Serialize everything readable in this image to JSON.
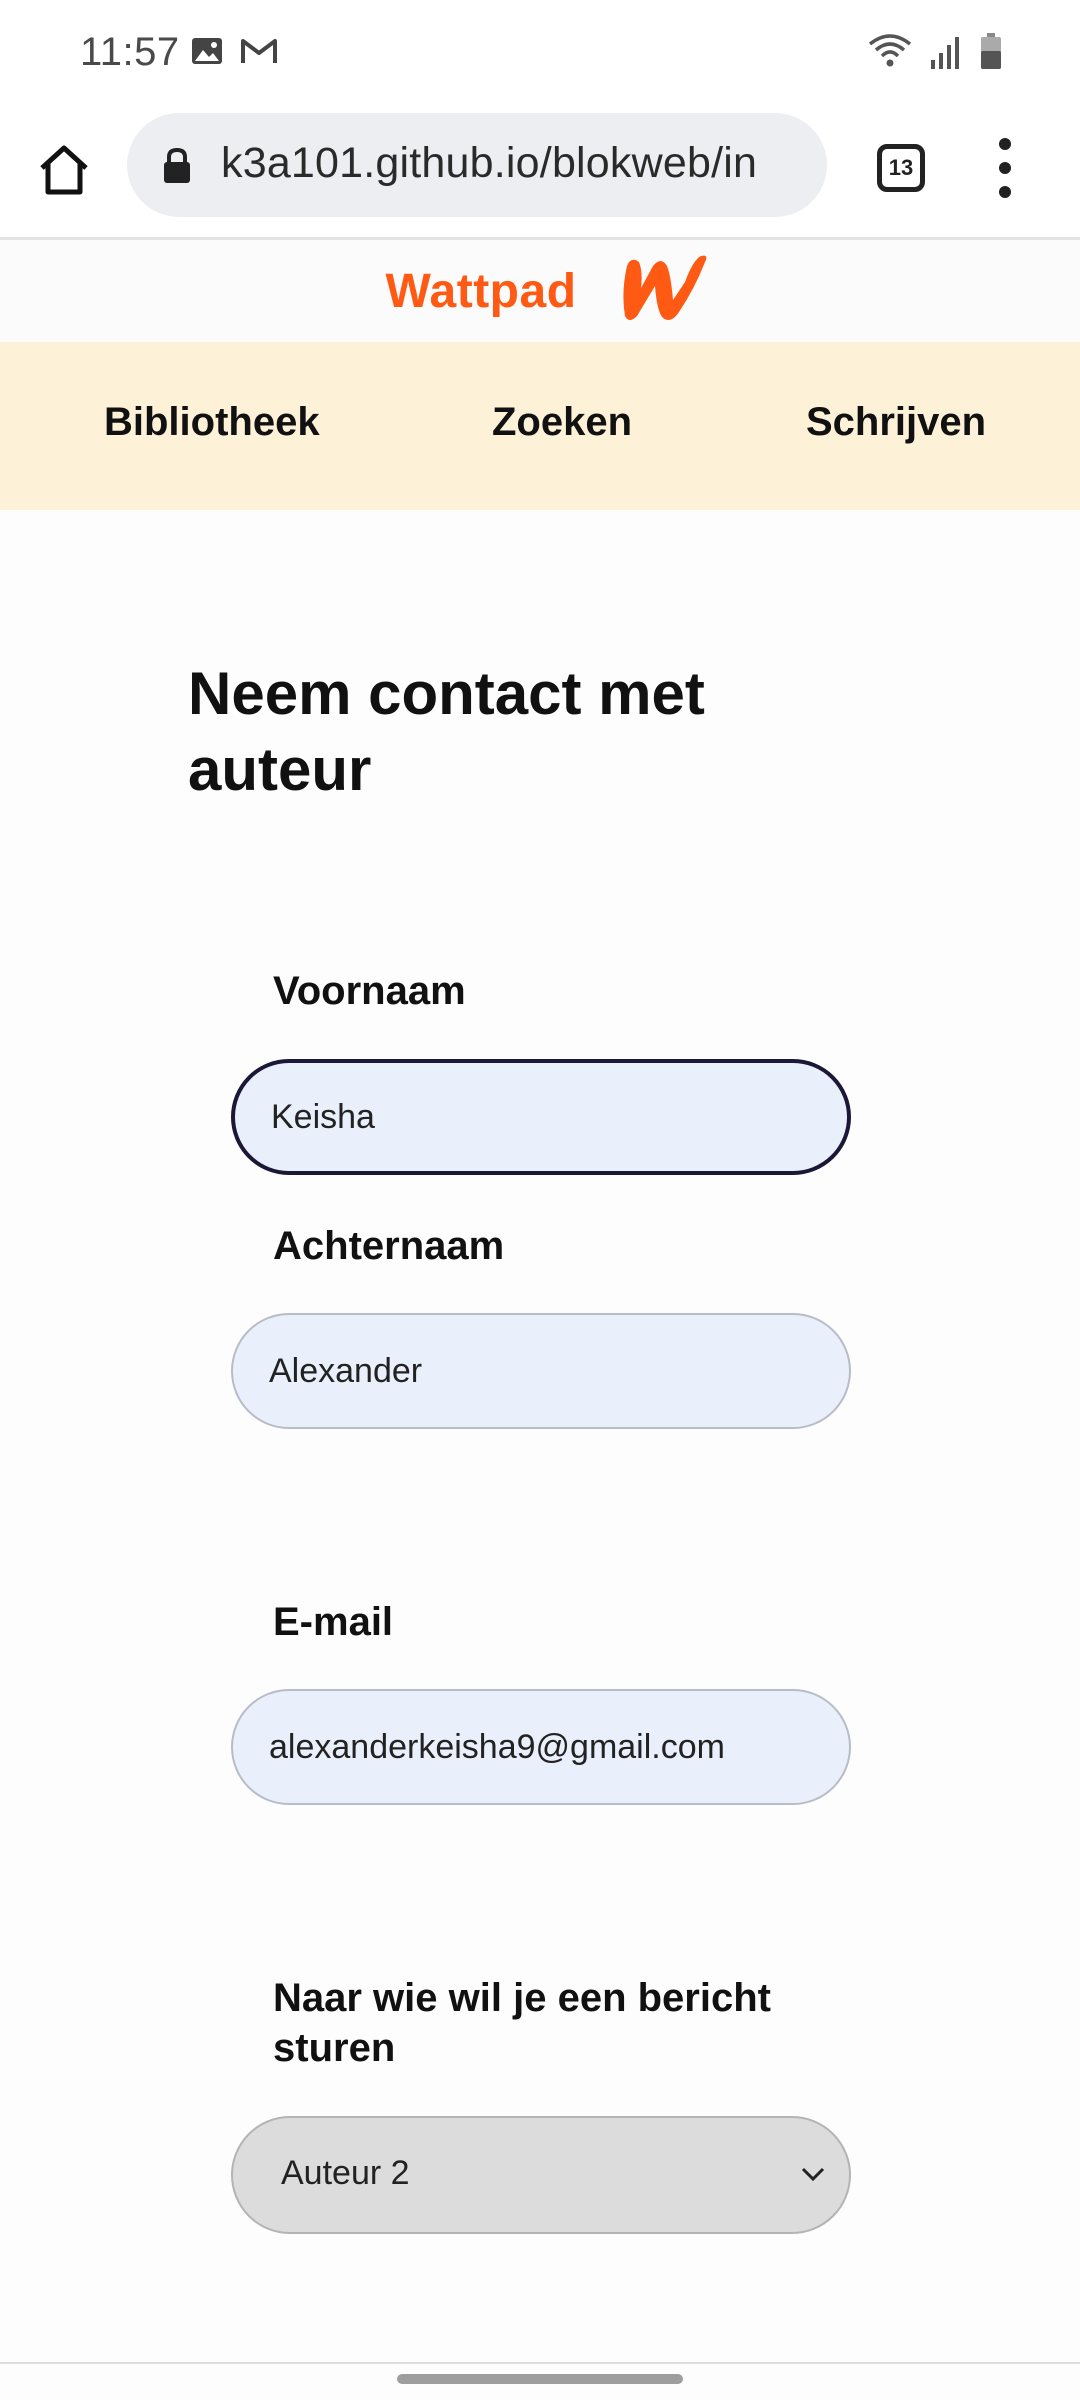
{
  "status_bar": {
    "time": "11:57",
    "icons": [
      "gallery-icon",
      "gmail-icon",
      "wifi-icon",
      "signal-icon",
      "battery-icon"
    ]
  },
  "browser": {
    "url": "k3a101.github.io/blokweb/in",
    "tab_count": "13",
    "icons": [
      "home-icon",
      "lock-icon",
      "tabs-icon",
      "more-vert-icon"
    ]
  },
  "header": {
    "brand": "Wattpad",
    "brand_color": "#ff5a14"
  },
  "nav": {
    "items": [
      {
        "label": "Bibliotheek"
      },
      {
        "label": "Zoeken"
      },
      {
        "label": "Schrijven"
      }
    ],
    "background": "#fdf1d8"
  },
  "main": {
    "title": "Neem contact met auteur",
    "fields": {
      "first_name": {
        "label": "Voornaam",
        "value": "Keisha"
      },
      "last_name": {
        "label": "Achternaam",
        "value": "Alexander"
      },
      "email": {
        "label": "E-mail",
        "value": "alexanderkeisha9@gmail.com"
      },
      "recipient": {
        "label": "Naar wie wil je een bericht sturen",
        "selected": "Auteur 2"
      }
    }
  }
}
